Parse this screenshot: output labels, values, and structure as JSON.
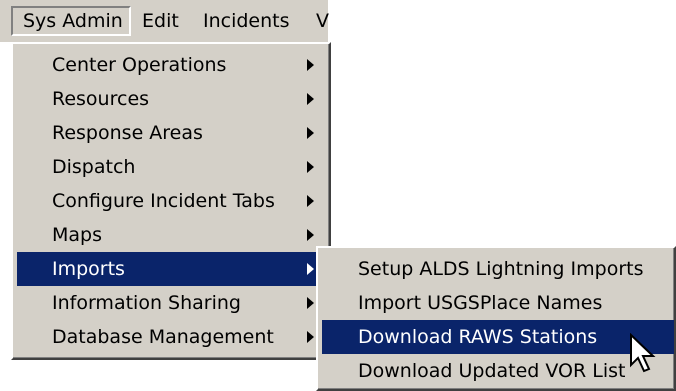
{
  "menubar": {
    "items": [
      {
        "label": "Sys Admin"
      },
      {
        "label": "Edit"
      },
      {
        "label": "Incidents"
      },
      {
        "label": "V"
      }
    ]
  },
  "sys_admin_menu": {
    "items": [
      {
        "label": "Center Operations",
        "has_submenu": true
      },
      {
        "label": "Resources",
        "has_submenu": true
      },
      {
        "label": "Response Areas",
        "has_submenu": true
      },
      {
        "label": "Dispatch",
        "has_submenu": true
      },
      {
        "label": "Configure Incident Tabs",
        "has_submenu": true
      },
      {
        "label": "Maps",
        "has_submenu": true
      },
      {
        "label": "Imports",
        "has_submenu": true,
        "highlighted": true
      },
      {
        "label": "Information Sharing",
        "has_submenu": true
      },
      {
        "label": "Database Management",
        "has_submenu": true
      }
    ]
  },
  "imports_submenu": {
    "items": [
      {
        "label": "Setup ALDS Lightning Imports"
      },
      {
        "label": "Import USGSPlace Names"
      },
      {
        "label": "Download RAWS Stations",
        "highlighted": true
      },
      {
        "label": "Download Updated VOR List"
      }
    ]
  },
  "colors": {
    "menu_face": "#d4d0c8",
    "highlight": "#0a246a",
    "highlight_text": "#ffffff"
  },
  "icons": {
    "submenu_arrow": "chevron-right-icon",
    "pointer": "mouse-pointer-icon"
  }
}
